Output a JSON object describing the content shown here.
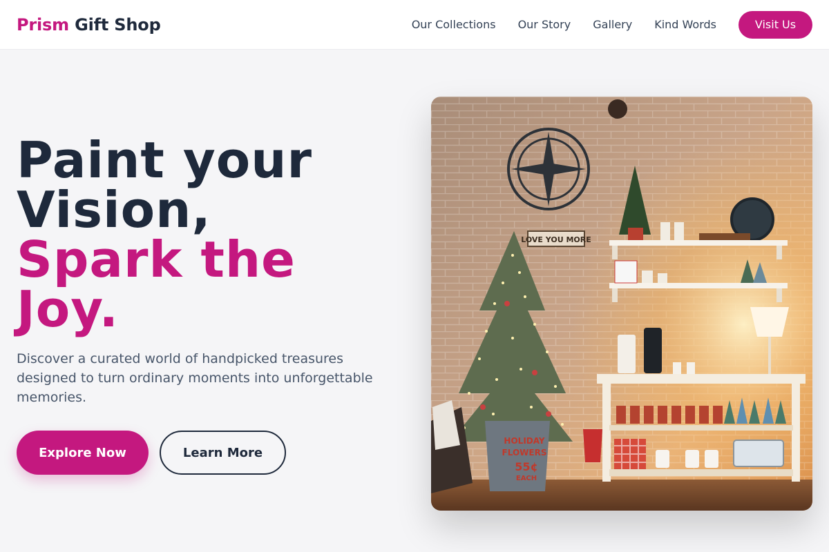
{
  "header": {
    "brand_accent": "Prism",
    "brand_rest": "Gift Shop",
    "nav": [
      "Our Collections",
      "Our Story",
      "Gallery",
      "Kind Words"
    ],
    "cta": "Visit Us"
  },
  "hero": {
    "headline_line1": "Paint your",
    "headline_line2": "Vision,",
    "headline_line3": "Spark the",
    "headline_line4": "Joy.",
    "subtext": "Discover a curated world of handpicked treasures designed to turn ordinary moments into unforgettable memories.",
    "primary_button": "Explore Now",
    "secondary_button": "Learn More"
  },
  "image": {
    "sign_text": "LOVE YOU MORE",
    "basket_line1": "HOLIDAY",
    "basket_line2": "FLOWERS",
    "basket_price": "55¢",
    "basket_each": "EACH"
  },
  "colors": {
    "accent": "#c4187f",
    "dark": "#1e293b",
    "muted": "#475569",
    "background": "#f5f5f7"
  }
}
